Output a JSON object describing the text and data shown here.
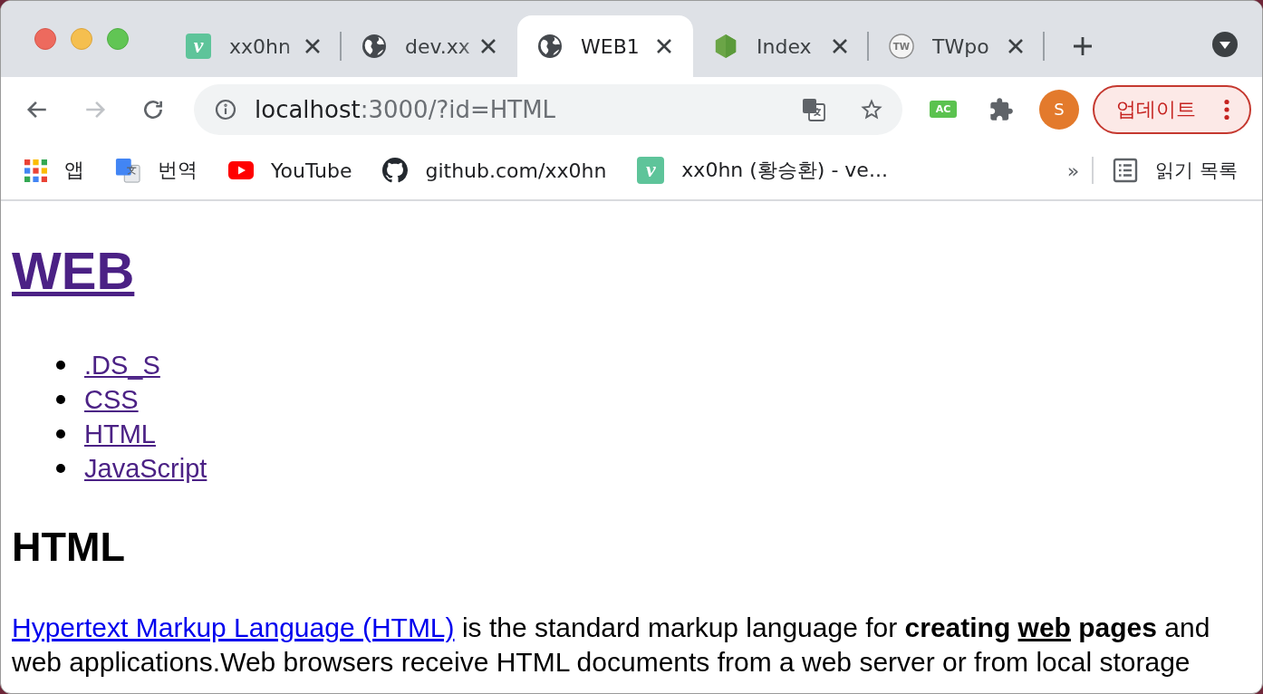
{
  "tabs": [
    {
      "title": "xx0hn",
      "favicon": {
        "kind": "letter-tile",
        "text": "v"
      },
      "selected": false
    },
    {
      "title": "dev.xx",
      "favicon": {
        "kind": "globe"
      },
      "selected": false
    },
    {
      "title": "WEB1",
      "favicon": {
        "kind": "globe"
      },
      "selected": true
    },
    {
      "title": "Index",
      "favicon": {
        "kind": "hexagon"
      },
      "selected": false
    },
    {
      "title": "TWpo",
      "favicon": {
        "kind": "letter-ring",
        "text": "TW"
      },
      "selected": false
    }
  ],
  "toolbar": {
    "back": {
      "disabled": false
    },
    "forward": {
      "disabled": true
    },
    "address": {
      "host": "localhost",
      "path": ":3000/?id=HTML"
    },
    "extension": {
      "label": "AC"
    },
    "profile": {
      "initial": "S"
    },
    "update_button": {
      "label": "업데이트"
    }
  },
  "bookmarks": {
    "items": [
      {
        "label": "앱",
        "icon": {
          "kind": "apps-grid"
        }
      },
      {
        "label": "번역",
        "icon": {
          "kind": "translate"
        }
      },
      {
        "label": "YouTube",
        "icon": {
          "kind": "play-tile"
        }
      },
      {
        "label": "github.com/xx0hn",
        "icon": {
          "kind": "cat"
        }
      },
      {
        "label": "xx0hn (황승환) - ve...",
        "icon": {
          "kind": "letter-tile",
          "text": "v"
        }
      }
    ],
    "overflow": "»",
    "reading_list": {
      "label": "읽기 목록"
    }
  },
  "page": {
    "title": {
      "text": "WEB",
      "visited": true
    },
    "links": [
      {
        "text": ".DS_S",
        "visited": true
      },
      {
        "text": "CSS",
        "visited": true
      },
      {
        "text": "HTML",
        "visited": true
      },
      {
        "text": "JavaScript",
        "visited": true
      }
    ],
    "heading": "HTML",
    "paragraph": [
      {
        "kind": "link",
        "text": "Hypertext Markup Language (HTML)",
        "visited": false
      },
      {
        "kind": "text",
        "text": " is the standard markup language for "
      },
      {
        "kind": "bold",
        "text": "creating "
      },
      {
        "kind": "bold-underline",
        "text": "web"
      },
      {
        "kind": "bold",
        "text": " pages"
      },
      {
        "kind": "text",
        "text": " and web applications.Web browsers receive HTML documents from a web server or from local storage"
      }
    ]
  }
}
